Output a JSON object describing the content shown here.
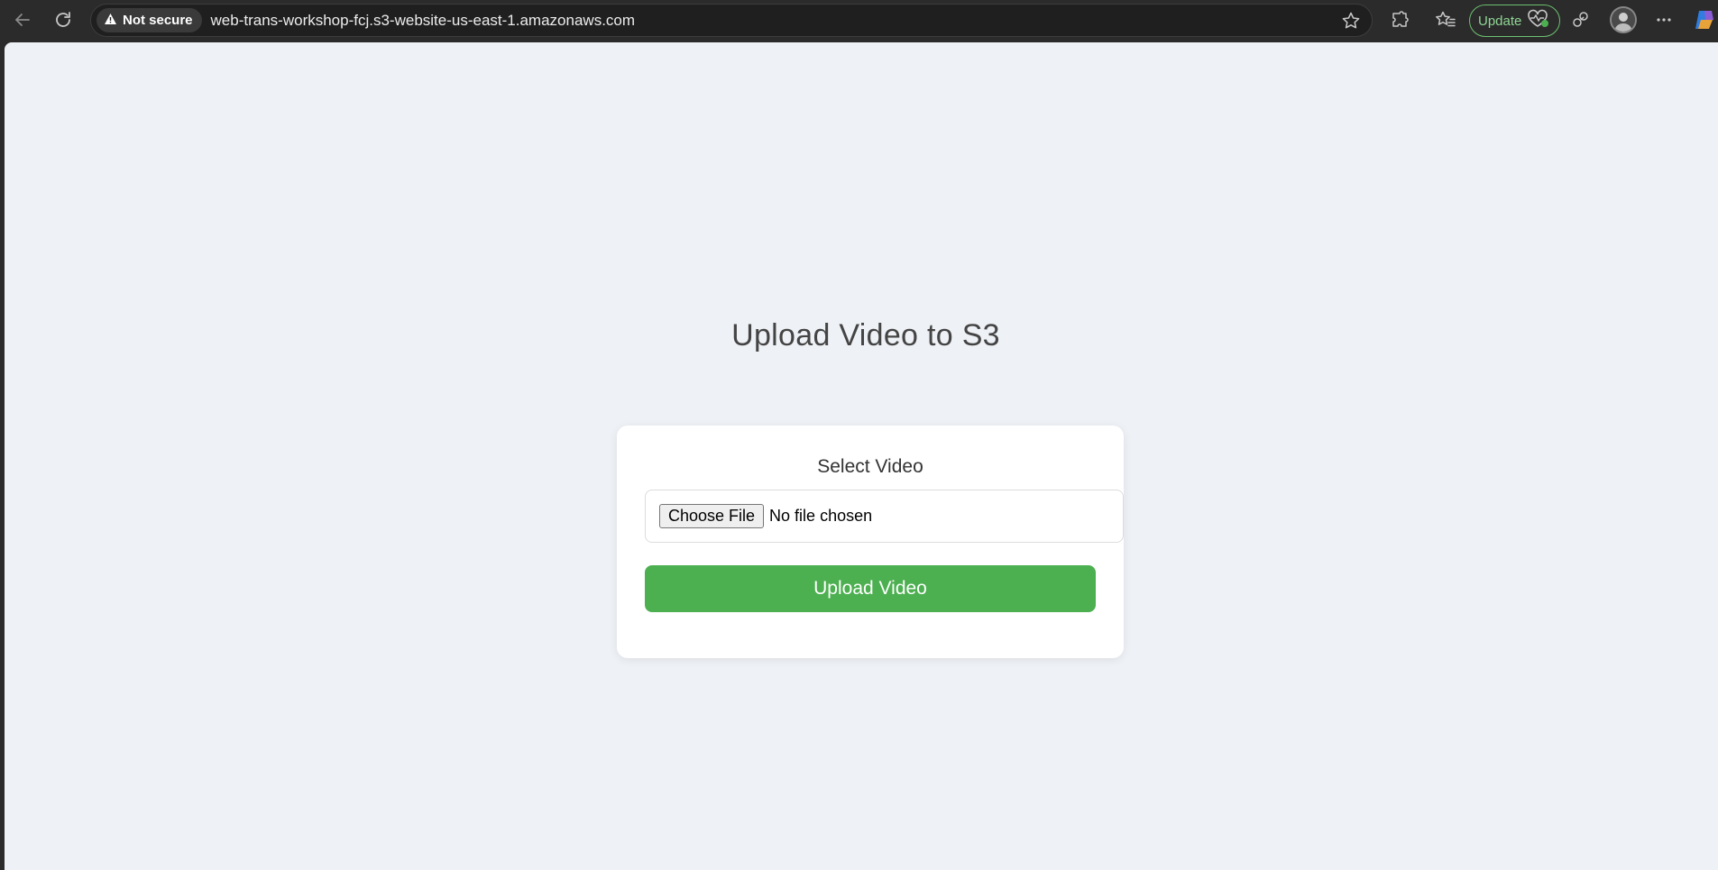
{
  "browser": {
    "security_label": "Not secure",
    "url": "web-trans-workshop-fcj.s3-website-us-east-1.amazonaws.com",
    "update_label": "Update",
    "icons": {
      "back": "back-arrow-icon",
      "reload": "reload-icon",
      "warning": "warning-icon",
      "star": "favorite-star-icon",
      "extensions": "extensions-icon",
      "favorites": "favorites-icon",
      "heart": "browser-essentials-icon",
      "collections": "collections-icon",
      "profile": "profile-avatar",
      "menu": "more-menu-icon",
      "copilot": "copilot-icon"
    }
  },
  "page": {
    "title": "Upload Video to S3",
    "form": {
      "label": "Select Video",
      "choose_file_label": "Choose File",
      "file_status": "No file chosen",
      "submit_label": "Upload Video"
    }
  },
  "colors": {
    "accent": "#4caf50",
    "page_background": "#eef1f5",
    "browser_chrome": "#2b2b2b"
  }
}
